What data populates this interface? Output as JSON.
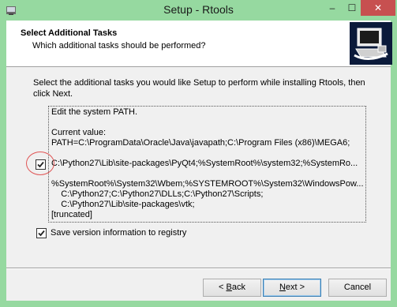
{
  "window": {
    "title": "Setup - Rtools",
    "minimize": "‒",
    "maximize": "☐",
    "close": "✕"
  },
  "header": {
    "title": "Select Additional Tasks",
    "subtitle": "Which additional tasks should be performed?"
  },
  "intro": "Select the additional tasks you would like Setup to perform while installing Rtools, then click Next.",
  "tasks": {
    "lines": [
      "Edit the system PATH.",
      "",
      "Current value:",
      "PATH=C:\\ProgramData\\Oracle\\Java\\javapath;C:\\Program Files (x86)\\MEGA6;",
      "",
      "C:\\Python27\\Lib\\site-packages\\PyQt4;%SystemRoot%\\system32;%SystemRo...",
      "",
      "%SystemRoot%\\System32\\Wbem;%SYSTEMROOT%\\System32\\WindowsPow...",
      "    C:\\Python27;C:\\Python27\\DLLs;C:\\Python27\\Scripts;",
      "    C:\\Python27\\Lib\\site-packages\\vtk;",
      "[truncated]"
    ],
    "edit_path_checked": true,
    "save_registry_checked": true,
    "save_registry_label": "Save version information to registry"
  },
  "buttons": {
    "back_prefix": "< ",
    "back_key": "B",
    "back_rest": "ack",
    "next_key": "N",
    "next_rest": "ext >",
    "cancel": "Cancel"
  }
}
